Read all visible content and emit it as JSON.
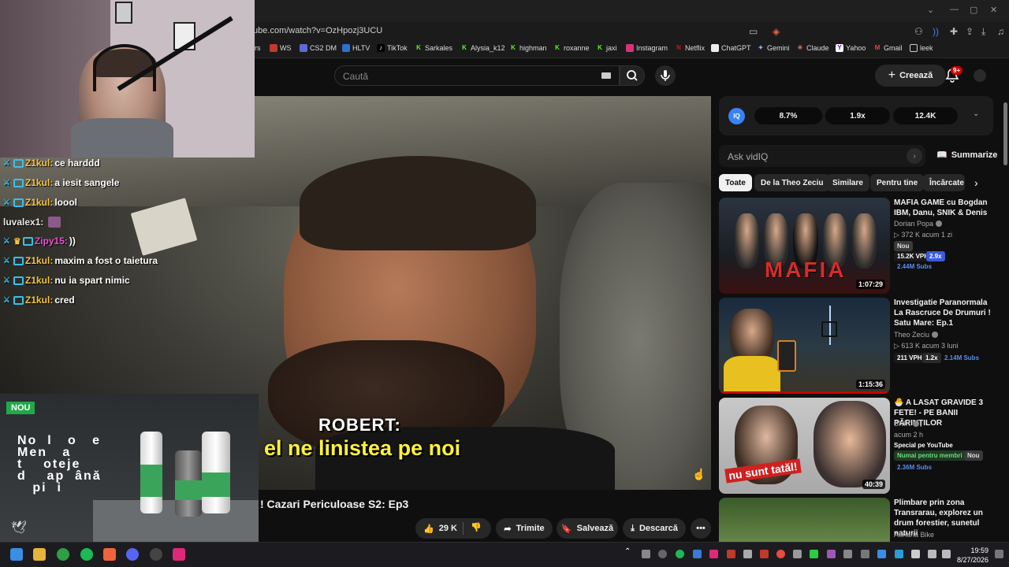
{
  "browser": {
    "url": "tube.com/watch?v=OzHpozj3UCU",
    "bookmarks": [
      "ers",
      "WS",
      "CS2 DM",
      "HLTV",
      "TikTok",
      "Sarkales",
      "Alysia_k12",
      "highman",
      "roxanne",
      "jaxi",
      "Instagram",
      "Netflix",
      "ChatGPT",
      "Gemini",
      "Claude",
      "Yahoo",
      "Gmail",
      "leek"
    ]
  },
  "header": {
    "search_placeholder": "Caută",
    "create_label": "Creează",
    "notification_count": "9+"
  },
  "video": {
    "subtitle_name": "ROBERT:",
    "subtitle_line": ". el ne linistea pe noi",
    "title_fragment": "! Cazari Periculoase S2: Ep3"
  },
  "actions": {
    "likes": "29 K",
    "share": "Trimite",
    "save": "Salvează",
    "download": "Descarcă"
  },
  "chat": [
    {
      "user": "Z1kul:",
      "msg": "ce harddd",
      "color": "#f5c542",
      "badges": true
    },
    {
      "user": "Z1kul:",
      "msg": "a iesit sangele",
      "color": "#f5c542",
      "badges": true
    },
    {
      "user": "Z1kul:",
      "msg": "loool",
      "color": "#f5c542",
      "badges": true
    },
    {
      "user": "luvalex1:",
      "msg": "",
      "color": "#e8e8e8",
      "badges": false
    },
    {
      "user": "Zipy15:",
      "msg": "))",
      "color": "#e84fd0",
      "badges": true
    },
    {
      "user": "Z1kul:",
      "msg": "maxim a fost o taietura",
      "color": "#f5c542",
      "badges": true
    },
    {
      "user": "Z1kul:",
      "msg": "nu ia spart nimic",
      "color": "#f5c542",
      "badges": true
    },
    {
      "user": "Z1kul:",
      "msg": "cred",
      "color": "#f5c542",
      "badges": true
    }
  ],
  "ad": {
    "badge": "NOU",
    "lines": [
      "No  l   o   e",
      "Men   a",
      "t    oteje",
      "d    ap  ână",
      "   pi  i"
    ]
  },
  "iq": {
    "logo": "IQ",
    "stats": [
      "8.7%",
      "1.9x",
      "12.4K"
    ],
    "ask_placeholder": "Ask vidIQ",
    "summarize": "Summarize"
  },
  "chips": [
    "Toate",
    "De la Theo Zeciu",
    "Similare",
    "Pentru tine",
    "Încărcate r"
  ],
  "recommendations": [
    {
      "title": "MAFIA GAME cu Bogdan IBM, Danu, SNIK & Denis",
      "channel": "Dorian Popa",
      "meta": "▷ 372 K   acum 1 zi",
      "duration": "1:07:29",
      "thumb_text": "MAFIA",
      "tags": [
        "Nou",
        "15.2K VPH",
        "2.9x",
        "2.44M Subs"
      ]
    },
    {
      "title": "Investigatie Paranormala La Rascruce De Drumuri ! Satu Mare: Ep.1",
      "channel": "Theo Zeciu",
      "meta": "▷ 613 K   acum 3 luni",
      "duration": "1:15:36",
      "thumb_text": "",
      "tags": [
        "211 VPH",
        "1.2x",
        "2.14M Subs"
      ]
    },
    {
      "title": "🐣 A LASAT GRAVIDE 3 FETE! - PE BANII PĂRINȚILOR",
      "channel": "SNIK",
      "meta": "acum 2 h",
      "duration": "40:39",
      "thumb_text": "nu sunt tatăl!",
      "tags": [
        "Special pe YouTube",
        "Numai pentru membri",
        "Nou",
        "2.36M Subs"
      ]
    },
    {
      "title": "Plimbare prin zona Transrarau, explorez un drum forestier, sunetul naturii",
      "channel": "Adriana Bike",
      "meta": "",
      "duration": "",
      "thumb_text": "",
      "tags": []
    }
  ],
  "taskbar": {
    "time": "19:59",
    "date": "8/27/2026"
  }
}
